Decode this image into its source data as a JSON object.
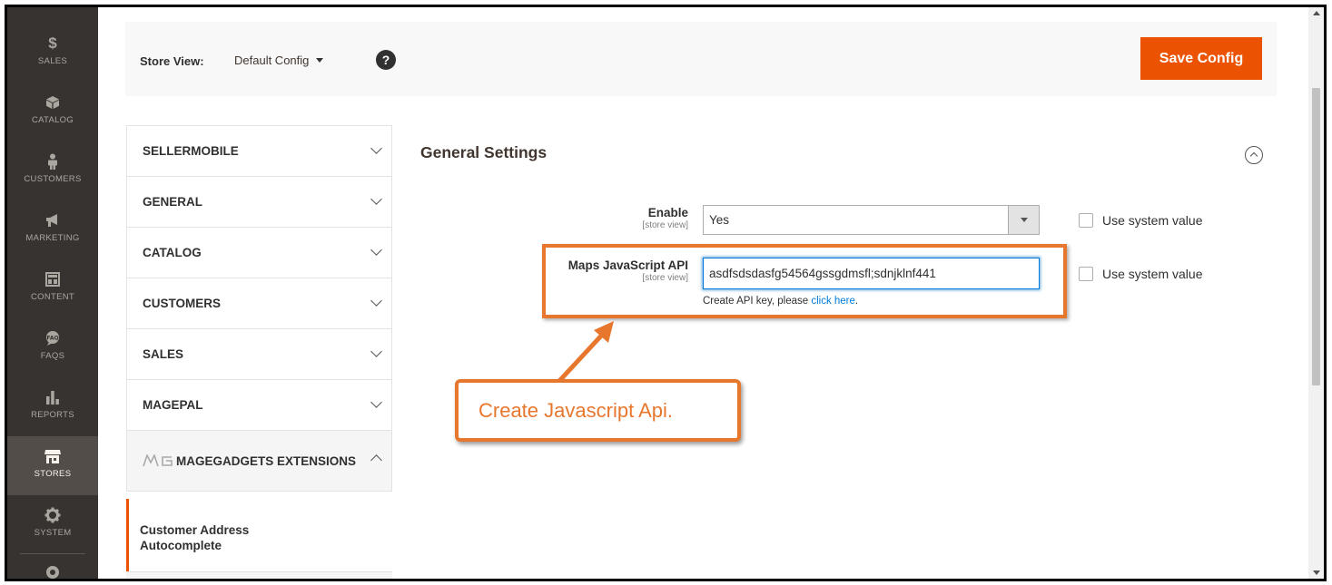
{
  "admin_nav": {
    "items": [
      {
        "label": "SALES",
        "icon": "dollar-icon"
      },
      {
        "label": "CATALOG",
        "icon": "cube-icon"
      },
      {
        "label": "CUSTOMERS",
        "icon": "person-icon"
      },
      {
        "label": "MARKETING",
        "icon": "megaphone-icon"
      },
      {
        "label": "CONTENT",
        "icon": "layout-icon"
      },
      {
        "label": "FAQS",
        "icon": "faq-icon"
      },
      {
        "label": "REPORTS",
        "icon": "bar-chart-icon"
      },
      {
        "label": "STORES",
        "icon": "store-icon"
      },
      {
        "label": "SYSTEM",
        "icon": "gear-icon"
      }
    ]
  },
  "header": {
    "store_view_label": "Store View:",
    "store_view_value": "Default Config",
    "help": "?",
    "save_label": "Save Config"
  },
  "tabs": {
    "items": [
      {
        "label": "SELLERMOBILE"
      },
      {
        "label": "GENERAL"
      },
      {
        "label": "CATALOG"
      },
      {
        "label": "CUSTOMERS"
      },
      {
        "label": "SALES"
      },
      {
        "label": "MAGEPAL"
      }
    ],
    "expanded_label": "MAGEGADGETS EXTENSIONS",
    "sub_item": "Customer Address Autocomplete"
  },
  "section": {
    "title": "General Settings",
    "fields": {
      "enable": {
        "label": "Enable",
        "scope": "[store view]",
        "value": "Yes",
        "system_value_label": "Use system value"
      },
      "maps_api": {
        "label": "Maps JavaScript API",
        "scope": "[store view]",
        "value": "asdfsdsdasfg54564gssgdmsfl;sdnjklnf441",
        "note_prefix": "Create API key, please ",
        "note_link": "click here",
        "note_suffix": ".",
        "system_value_label": "Use system value"
      }
    }
  },
  "annotation": {
    "callout_text": "Create Javascript Api.",
    "color": "#e8772e"
  },
  "colors": {
    "accent": "#eb5202",
    "nav_bg": "#373330",
    "link": "#007bdb"
  }
}
